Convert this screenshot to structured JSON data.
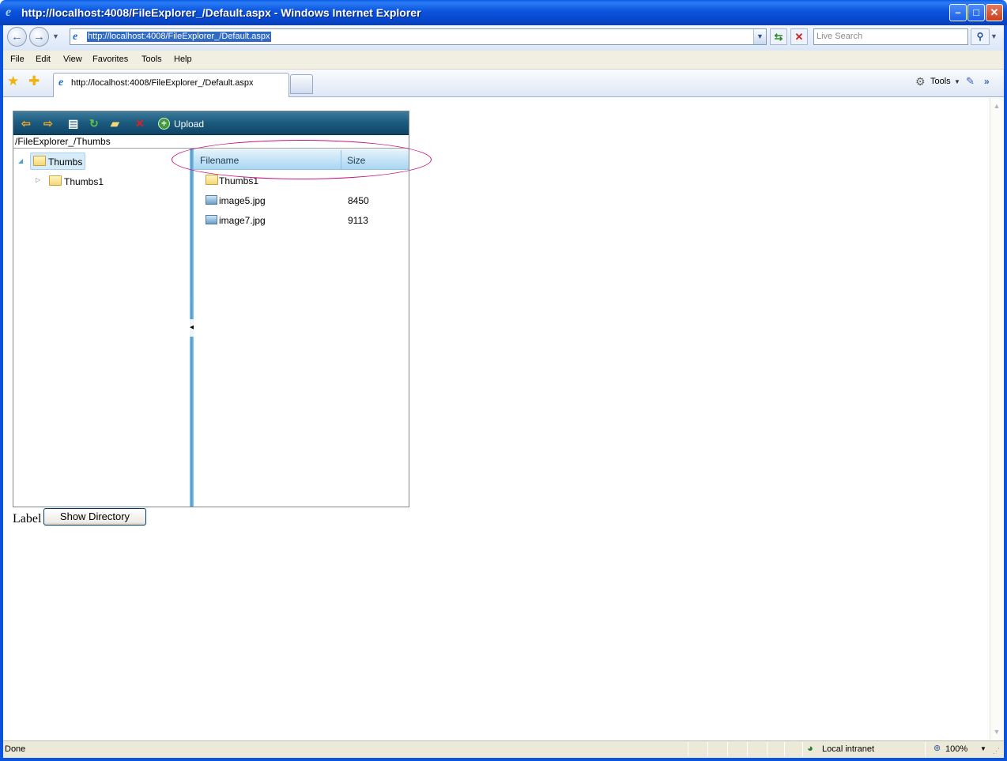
{
  "window": {
    "title": "http://localhost:4008/FileExplorer_/Default.aspx - Windows Internet Explorer",
    "minimize_glyph": "–",
    "maximize_glyph": "□",
    "close_glyph": "✕"
  },
  "address_bar": {
    "url": "http://localhost:4008/FileExplorer_/Default.aspx",
    "search_placeholder": "Live Search"
  },
  "menu": [
    "File",
    "Edit",
    "View",
    "Favorites",
    "Tools",
    "Help"
  ],
  "tabs": {
    "active_label": "http://localhost:4008/FileExplorer_/Default.aspx"
  },
  "command_bar": {
    "tools_label": "Tools"
  },
  "file_explorer": {
    "upload_label": "Upload",
    "current_path": "/FileExplorer_/Thumbs",
    "tree": {
      "root": "Thumbs",
      "children": [
        "Thumbs1"
      ]
    },
    "grid": {
      "columns": [
        "Filename",
        "Size"
      ],
      "rows": [
        {
          "type": "folder",
          "name": "Thumbs1",
          "size": ""
        },
        {
          "type": "image",
          "name": "image5.jpg",
          "size": "8450"
        },
        {
          "type": "image",
          "name": "image7.jpg",
          "size": "9113"
        }
      ]
    },
    "highlight_color": "#c8157f"
  },
  "page": {
    "label": "Label",
    "show_directory_button": "Show Directory"
  },
  "status_bar": {
    "text": "Done",
    "zone": "Local intranet",
    "zoom": "100%"
  }
}
